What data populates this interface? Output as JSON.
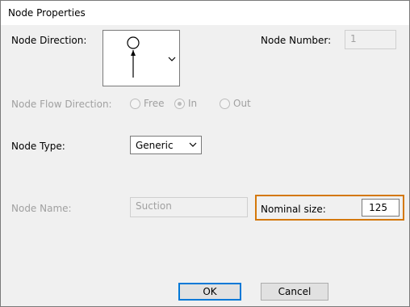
{
  "window": {
    "title": "Node Properties"
  },
  "node_direction": {
    "label": "Node Direction:",
    "icon": "node-arrow-up-icon"
  },
  "node_number": {
    "label": "Node Number:",
    "value": "1"
  },
  "flow_direction": {
    "label": "Node Flow Direction:",
    "options": [
      {
        "label": "Free",
        "checked": false
      },
      {
        "label": "In",
        "checked": true
      },
      {
        "label": "Out",
        "checked": false
      }
    ]
  },
  "node_type": {
    "label": "Node Type:",
    "selected": "Generic"
  },
  "node_name": {
    "label": "Node Name:",
    "value": "Suction"
  },
  "nominal_size": {
    "label": "Nominal size:",
    "value": "125",
    "highlight_color": "#d4780a"
  },
  "buttons": {
    "ok": "OK",
    "cancel": "Cancel"
  }
}
